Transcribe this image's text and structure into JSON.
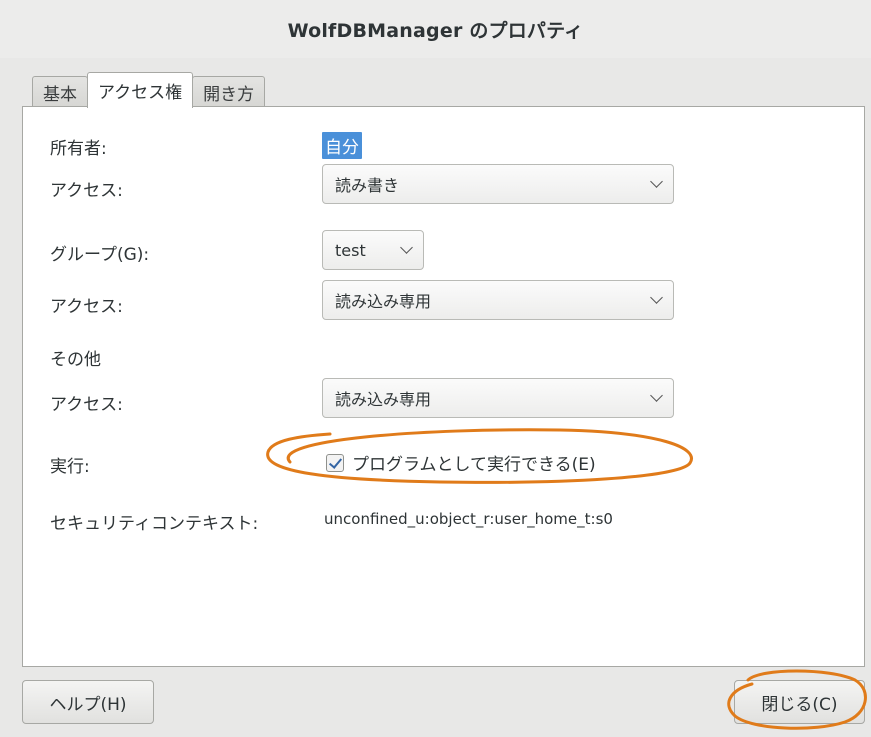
{
  "window": {
    "title": "WolfDBManager のプロパティ"
  },
  "tabs": [
    {
      "label": "基本",
      "active": false
    },
    {
      "label": "アクセス権",
      "active": true
    },
    {
      "label": "開き方",
      "active": false
    }
  ],
  "owner": {
    "label": "所有者:",
    "value": "自分",
    "access_label": "アクセス:",
    "access_value": "読み書き"
  },
  "group": {
    "label": "グループ(G):",
    "value": "test",
    "access_label": "アクセス:",
    "access_value": "読み込み専用"
  },
  "other": {
    "label": "その他",
    "access_label": "アクセス:",
    "access_value": "読み込み専用"
  },
  "execute": {
    "label": "実行:",
    "checkbox_label": "プログラムとして実行できる(E)",
    "checked": true
  },
  "security": {
    "label": "セキュリティコンテキスト:",
    "value": "unconfined_u:object_r:user_home_t:s0"
  },
  "buttons": {
    "help": "ヘルプ(H)",
    "close": "閉じる(C)"
  },
  "colors": {
    "annotation": "#e07b1a",
    "selection": "#4a90d9",
    "checkmark": "#3465a4"
  }
}
